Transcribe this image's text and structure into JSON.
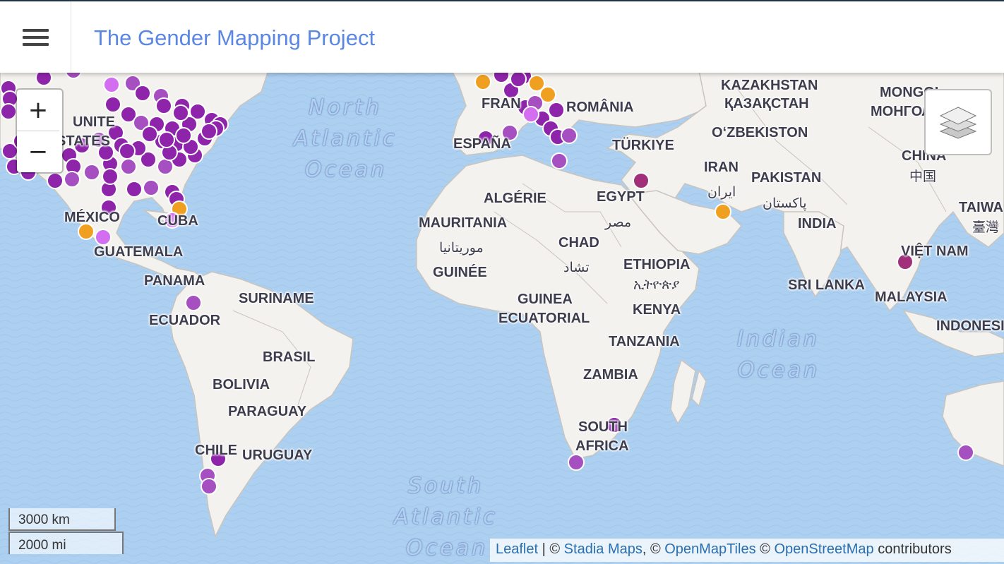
{
  "header": {
    "title": "The Gender Mapping Project"
  },
  "controls": {
    "zoom_in": "+",
    "zoom_out": "−"
  },
  "scale": {
    "metric": "3000 km",
    "imperial": "2000 mi"
  },
  "attribution": {
    "leaflet": "Leaflet",
    "sep1": " | © ",
    "stadia": "Stadia Maps",
    "sep2": ", © ",
    "omt": "OpenMapTiles",
    "sep3": " © ",
    "osm": "OpenStreetMap",
    "suffix": " contributors"
  },
  "map_labels": {
    "kazakhstan": "KAZAKHSTAN",
    "kazakhstan_local": "ҚАЗАҚСТАН",
    "mongolia": "MONGOL",
    "mongolia_local": "МОНГОЛ",
    "uzbekistan": "OʻZBEKISTON",
    "romania": "ROMÂNIA",
    "france": "FRAN",
    "espana": "ESPAÑA",
    "turkiye": "TÜRKIYE",
    "iran": "IRAN",
    "iran_local": "ایران",
    "pakistan": "PAKISTAN",
    "pakistan_local": "پاکستان",
    "china": "CHINA",
    "china_local": "中国",
    "taiwan": "TAIWA",
    "taiwan_local": "臺灣",
    "india": "INDIA",
    "vietnam": "VIỆT NAM",
    "sri_lanka": "SRI LANKA",
    "malaysia": "MALAYSIA",
    "indonesia": "INDONESI",
    "egypt": "EGYPT",
    "egypt_local": "مصر",
    "algerie": "ALGÉRIE",
    "mauritania": "MAURITANIA",
    "mauritania_local": "موريتانيا",
    "guinee": "GUINÉE",
    "chad": "CHAD",
    "chad_local": "تشاد",
    "ethiopia": "ETHIOPIA",
    "ethiopia_local": "ኢትዮጵያ",
    "kenya": "KENYA",
    "guinea": "GUINEA",
    "ecuatorial": "ECUATORIAL",
    "tanzania": "TANZANIA",
    "zambia": "ZAMBIA",
    "south": "SOUTH",
    "africa": "AFRICA",
    "united": "UNITE",
    "states": "STATES",
    "mexico": "MÉXICO",
    "cuba": "CUBA",
    "guatemala": "GUATEMALA",
    "panama": "PANAMA",
    "ecuador": "ECUADOR",
    "suriname": "SURINAME",
    "brasil": "BRASIL",
    "bolivia": "BOLIVIA",
    "paraguay": "PARAGUAY",
    "chile": "CHILE",
    "uruguay": "URUGUAY",
    "north_atlantic": [
      "North",
      "Atlantic",
      "Ocean"
    ],
    "south_atlantic": [
      "South",
      "Atlantic",
      "Ocean"
    ],
    "indian_ocean": [
      "Indian",
      "Ocean"
    ]
  },
  "marker_colors": {
    "purple": "#8e24aa",
    "light_purple": "#d46ef0",
    "violet": "#a64fc0",
    "magenta": "#a0307a",
    "orange": "#f0a020"
  },
  "icons": {
    "menu": "hamburger-menu-icon",
    "layers": "layers-icon"
  }
}
